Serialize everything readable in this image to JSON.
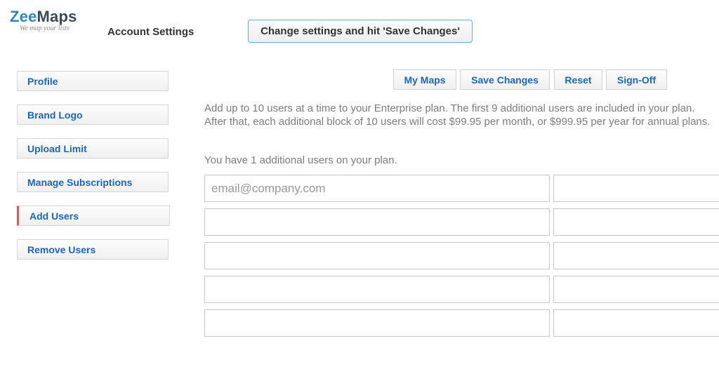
{
  "logo": {
    "brand_part1": "Zee",
    "brand_part2": "Maps",
    "tagline": "We map your lists"
  },
  "header": {
    "title": "Account Settings",
    "notice": "Change settings and hit 'Save Changes'"
  },
  "sidebar": {
    "items": [
      {
        "label": "Profile",
        "active": false
      },
      {
        "label": "Brand Logo",
        "active": false
      },
      {
        "label": "Upload Limit",
        "active": false
      },
      {
        "label": "Manage Subscriptions",
        "active": false
      },
      {
        "label": "Add Users",
        "active": true
      },
      {
        "label": "Remove Users",
        "active": false
      }
    ]
  },
  "toolbar": {
    "my_maps": "My Maps",
    "save_changes": "Save Changes",
    "reset": "Reset",
    "sign_off": "Sign-Off"
  },
  "content": {
    "description": "Add up to 10 users at a time to your Enterprise plan. The first 9 additional users are included in your plan. After that, each additional block of 10 users will cost $99.95 per month, or $999.95 per year for annual plans.",
    "user_count_text": "You have 1 additional users on your plan.",
    "email_placeholder": "email@company.com"
  },
  "colors": {
    "link_blue": "#1a66c2",
    "active_marker": "#e05a52",
    "notice_border": "#6fa8dc"
  }
}
